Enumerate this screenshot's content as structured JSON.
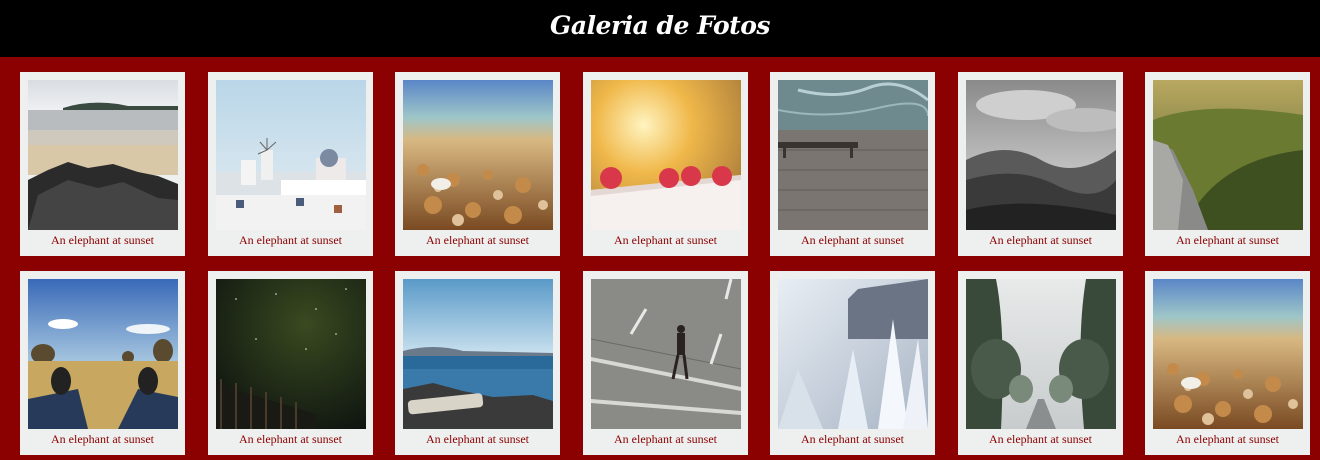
{
  "header": {
    "title": "Galeria de Fotos"
  },
  "colors": {
    "background": "#8b0000",
    "header": "#000000",
    "card": "#eef0f0",
    "caption": "#8b0000"
  },
  "gallery": [
    {
      "caption": "An elephant at sunset",
      "photo": "beach-rocks"
    },
    {
      "caption": "An elephant at sunset",
      "photo": "santorini-windmills"
    },
    {
      "caption": "An elephant at sunset",
      "photo": "pebble-beach"
    },
    {
      "caption": "An elephant at sunset",
      "photo": "raspberries"
    },
    {
      "caption": "An elephant at sunset",
      "photo": "lake-pier-bench"
    },
    {
      "caption": "An elephant at sunset",
      "photo": "bw-valley"
    },
    {
      "caption": "An elephant at sunset",
      "photo": "forest-mountain"
    },
    {
      "caption": "An elephant at sunset",
      "photo": "feet-on-grass"
    },
    {
      "caption": "An elephant at sunset",
      "photo": "night-sky-fence"
    },
    {
      "caption": "An elephant at sunset",
      "photo": "rocky-shore"
    },
    {
      "caption": "An elephant at sunset",
      "photo": "man-crossing-street"
    },
    {
      "caption": "An elephant at sunset",
      "photo": "frosted-plants"
    },
    {
      "caption": "An elephant at sunset",
      "photo": "foggy-tree-road"
    },
    {
      "caption": "An elephant at sunset",
      "photo": "pebble-beach"
    }
  ]
}
